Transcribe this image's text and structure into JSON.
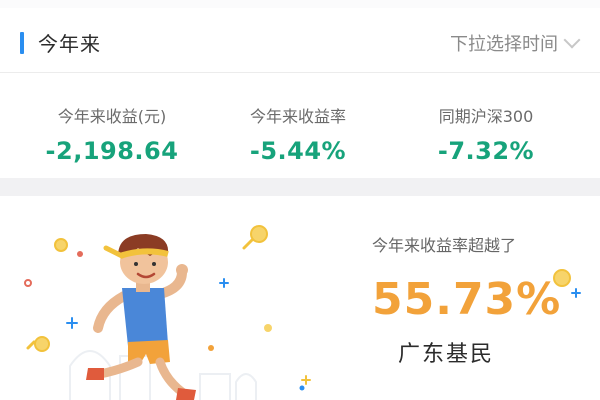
{
  "header": {
    "title": "今年来",
    "picker_label": "下拉选择时间"
  },
  "stats": [
    {
      "label": "今年来收益(元)",
      "value": "-2,198.64"
    },
    {
      "label": "今年来收益率",
      "value": "-5.44%"
    },
    {
      "label": "同期沪深300",
      "value": "-7.32%"
    }
  ],
  "card": {
    "caption": "今年来收益率超越了",
    "percent": "55.73%",
    "region": "广东基民"
  },
  "colors": {
    "accent_blue": "#2a8ef0",
    "negative_green": "#17a37b",
    "highlight_orange": "#f2a23a"
  },
  "icons": {
    "illustration": "running-man-icon",
    "picker": "chevron-down-icon"
  }
}
